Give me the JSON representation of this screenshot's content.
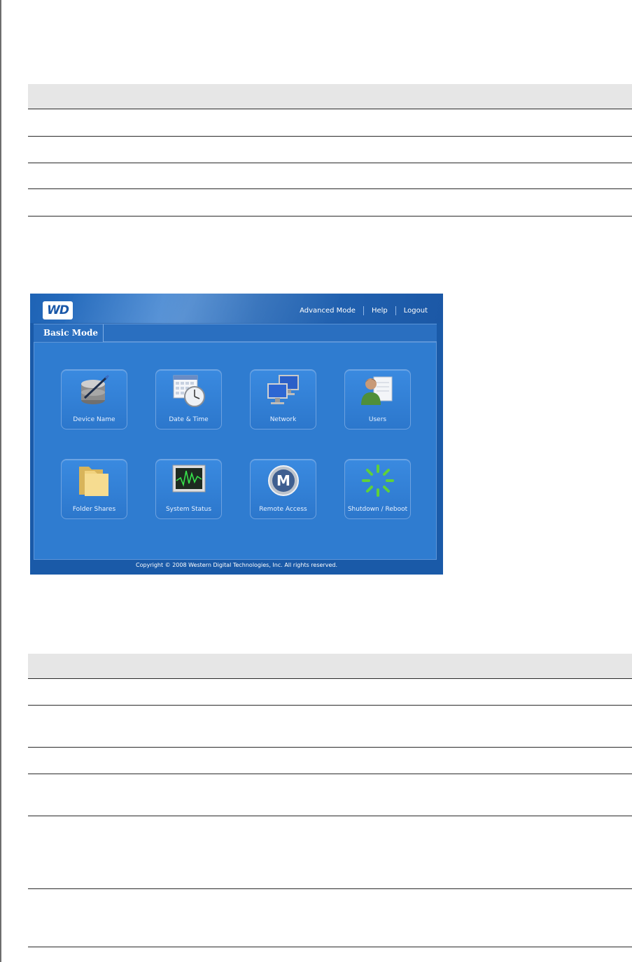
{
  "screenshot": {
    "logo_text": "WD",
    "nav": [
      "Advanced Mode",
      "Help",
      "Logout"
    ],
    "tab_label": "Basic Mode",
    "tiles": [
      {
        "label": "Device Name",
        "icon": "database-pen-icon"
      },
      {
        "label": "Date & Time",
        "icon": "calendar-clock-icon"
      },
      {
        "label": "Network",
        "icon": "network-computers-icon"
      },
      {
        "label": "Users",
        "icon": "user-icon"
      },
      {
        "label": "Folder Shares",
        "icon": "folder-icon"
      },
      {
        "label": "System Status",
        "icon": "monitor-chart-icon"
      },
      {
        "label": "Remote Access",
        "icon": "m-logo-icon"
      },
      {
        "label": "Shutdown / Reboot",
        "icon": "spinner-icon"
      }
    ],
    "copyright": "Copyright © 2008 Western Digital Technologies, Inc. All rights reserved."
  },
  "colors": {
    "header_blue": "#1e63b5",
    "panel_blue": "#2f7cd0",
    "spinner_green": "#5fd13a"
  }
}
